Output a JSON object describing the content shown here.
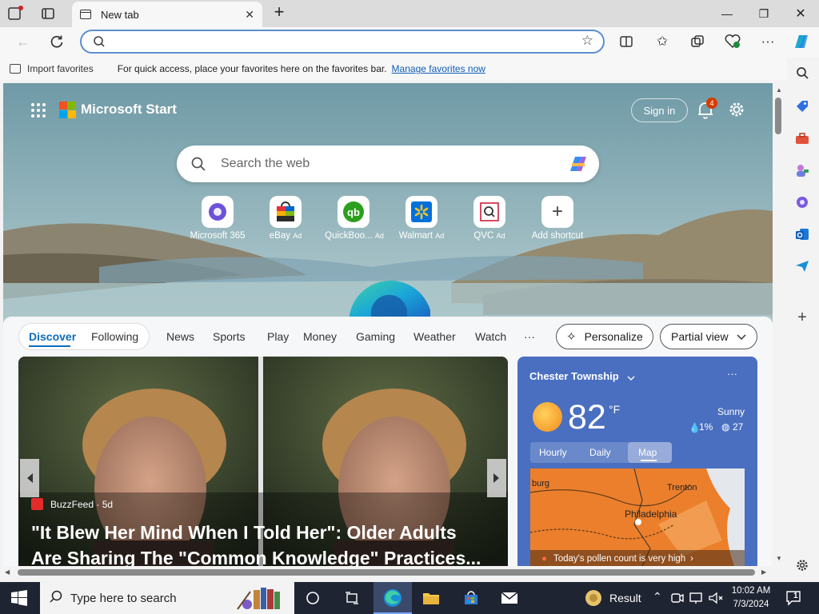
{
  "browser": {
    "tab_title": "New tab",
    "tab_close": "✕",
    "new_tab": "+",
    "win_min": "—",
    "win_max": "❐",
    "win_close": "✕",
    "address_value": "",
    "favorites": {
      "import_label": "Import favorites",
      "message": "For quick access, place your favorites here on the favorites bar.",
      "manage_link": "Manage favorites now"
    }
  },
  "start": {
    "brand": "Microsoft Start",
    "sign_in": "Sign in",
    "notif_count": "4",
    "search_placeholder": "Search the web",
    "shortcuts": [
      {
        "label": "Microsoft 365",
        "ad": ""
      },
      {
        "label": "eBay",
        "ad": "Ad"
      },
      {
        "label": "QuickBoo...",
        "ad": "Ad"
      },
      {
        "label": "Walmart",
        "ad": "Ad"
      },
      {
        "label": "QVC",
        "ad": "Ad"
      },
      {
        "label": "Add shortcut",
        "ad": ""
      }
    ],
    "nav": {
      "discover": "Discover",
      "following": "Following",
      "items": [
        "News",
        "Sports",
        "Play",
        "Money",
        "Gaming",
        "Weather",
        "Watch"
      ],
      "more": "···",
      "personalize": "Personalize",
      "view": "Partial view"
    },
    "hero": {
      "source": "BuzzFeed · 5d",
      "headline_1": "\"It Blew Her Mind When I Told Her\": Older Adults",
      "headline_2": "Are Sharing The \"Common Knowledge\" Practices..."
    },
    "weather": {
      "location": "Chester Township",
      "temp": "82",
      "unit": "°F",
      "condition": "Sunny",
      "precip": "1%",
      "aqi": "27",
      "tabs": [
        "Hourly",
        "Daily",
        "Map"
      ],
      "map_labels": [
        "burg",
        "Trenton",
        "Philadelphia"
      ],
      "pollen": "Today's pollen count is very high"
    }
  },
  "taskbar": {
    "search_placeholder": "Type here to search",
    "result_label": "Result",
    "time": "10:02 AM",
    "date": "7/3/2024",
    "notif_count": "1"
  },
  "colors": {
    "accent": "#0f6cbd",
    "taskbar": "#1f2433",
    "weather_card": "#4a6fc0"
  }
}
